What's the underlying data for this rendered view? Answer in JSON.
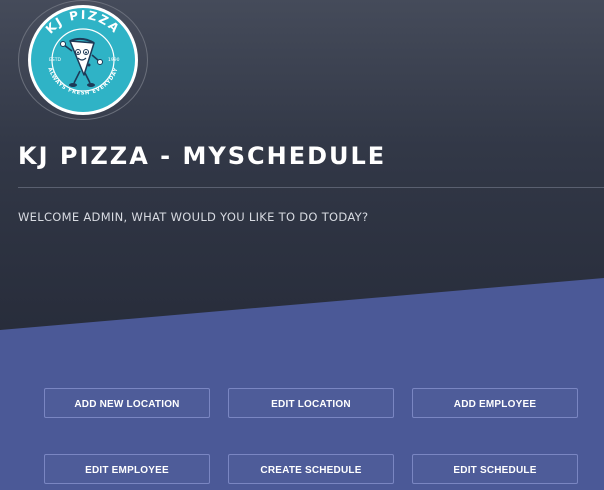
{
  "app": {
    "title": "KJ PIZZA - MYSCHEDULE",
    "welcome": "WELCOME ADMIN, WHAT WOULD YOU LIKE TO DO TODAY?"
  },
  "logo": {
    "brand": "KJ PIZZA",
    "tagline": "ALWAYS FRESH EVERYDAY",
    "left_mark": "ESTD",
    "right_mark": "1990",
    "colors": {
      "ring": "#2fb3c6",
      "dark": "#1d3a57",
      "bg": "#ffffff"
    }
  },
  "colors": {
    "header_bg_top": "#454b5a",
    "header_bg_bottom": "#23283a",
    "accent_band": "#4b5997",
    "button_border": "#7a86c2",
    "text_light": "#ffffff"
  },
  "actions": {
    "add_location": "ADD NEW LOCATION",
    "edit_location": "EDIT LOCATION",
    "add_employee": "ADD EMPLOYEE",
    "edit_employee": "EDIT EMPLOYEE",
    "create_schedule": "CREATE SCHEDULE",
    "edit_schedule": "EDIT SCHEDULE"
  }
}
